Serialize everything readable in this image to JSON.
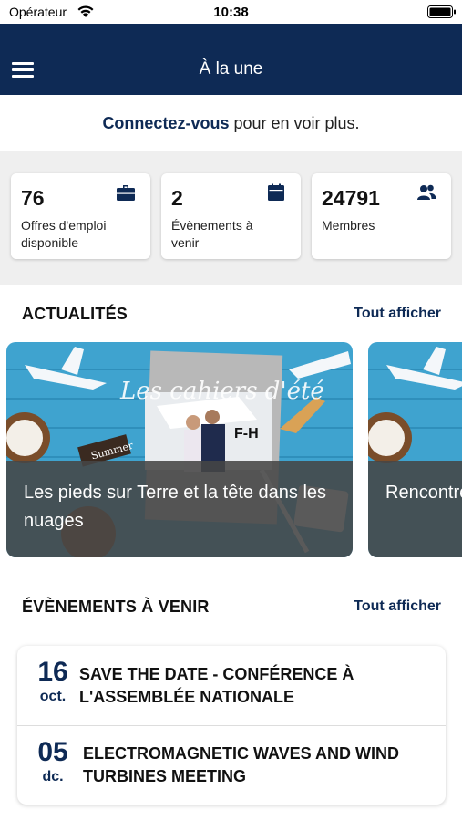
{
  "status_bar": {
    "carrier": "Opérateur",
    "time": "10:38"
  },
  "nav": {
    "title": "À la une"
  },
  "connect": {
    "link_text": "Connectez-vous",
    "rest_text": " pour en voir plus."
  },
  "stats": [
    {
      "value": "76",
      "label": "Offres d'emploi disponible",
      "icon": "briefcase-icon"
    },
    {
      "value": "2",
      "label": "Évènements à venir",
      "icon": "calendar-icon"
    },
    {
      "value": "24791",
      "label": "Membres",
      "icon": "users-icon"
    }
  ],
  "news": {
    "section_title": "ACTUALITÉS",
    "show_all": "Tout afficher",
    "items": [
      {
        "title": "Les pieds sur Terre et la tête dans les nuages",
        "image_text": "Les cahiers d'été",
        "sign_text": "Summer",
        "plane_text": "F-H"
      },
      {
        "title": "Rencontre Touzalin"
      }
    ]
  },
  "events": {
    "section_title": "ÉVÈNEMENTS À VENIR",
    "show_all": "Tout afficher",
    "items": [
      {
        "day": "16",
        "month": "oct.",
        "title": "SAVE THE DATE - CONFÉRENCE À L'ASSEMBLÉE NATIONALE"
      },
      {
        "day": "05",
        "month": "dc.",
        "title": "ELECTROMAGNETIC WAVES AND WIND TURBINES MEETING"
      }
    ]
  },
  "colors": {
    "navy": "#0e2a55",
    "background_gray": "#efefef",
    "overlay": "#464646"
  }
}
